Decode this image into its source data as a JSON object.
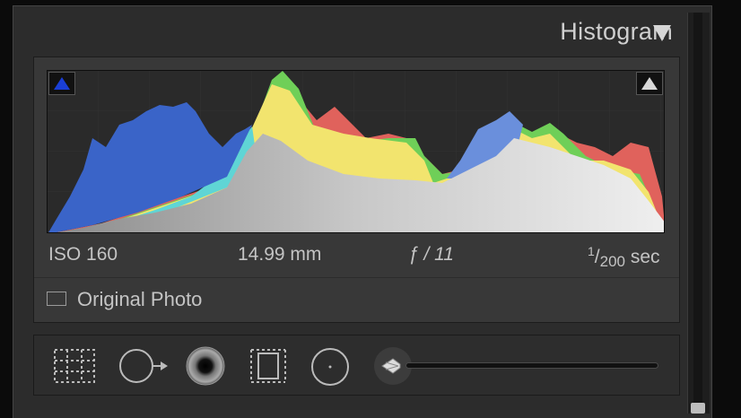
{
  "panel": {
    "title": "Histogram",
    "collapse_icon": "triangle-down-icon"
  },
  "histogram": {
    "shadow_clip_icon": "triangle-up-icon",
    "highlight_clip_icon": "triangle-up-icon",
    "shadow_clip_color": "#1a3fd6",
    "highlight_clip_color": "#d8d8d8"
  },
  "exif": {
    "iso": "ISO 160",
    "focal_length": "14.99 mm",
    "aperture": "ƒ / 11",
    "shutter_numerator": "1",
    "shutter_slash": "/",
    "shutter_denominator": "200",
    "shutter_unit": "sec"
  },
  "original_photo": {
    "label": "Original Photo",
    "checked": false
  },
  "tools": [
    {
      "name": "crop-overlay-icon"
    },
    {
      "name": "spot-removal-icon"
    },
    {
      "name": "red-eye-icon"
    },
    {
      "name": "graduated-filter-icon"
    },
    {
      "name": "radial-filter-icon"
    },
    {
      "name": "adjustment-brush-icon"
    }
  ],
  "colors": {
    "blue": "#3a64c8",
    "yellow": "#f2e46e",
    "red": "#e0625c",
    "green": "#6fcf58",
    "gray": "#cdcdcd"
  }
}
